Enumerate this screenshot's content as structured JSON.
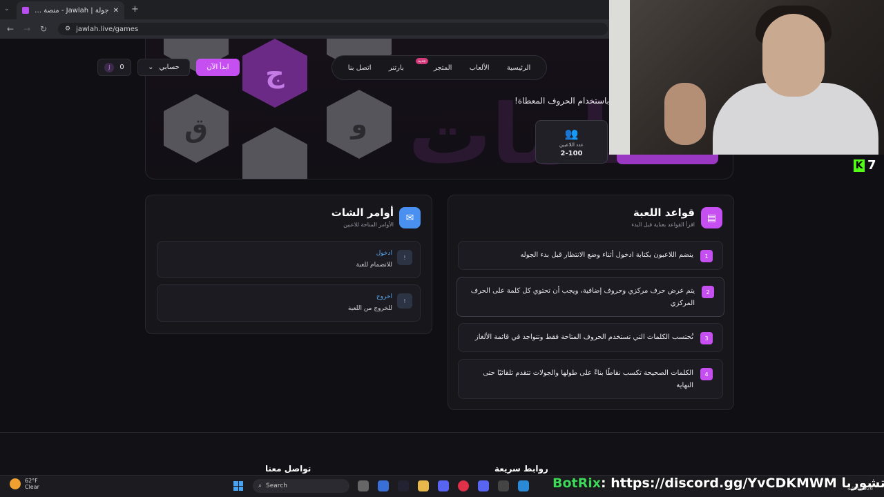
{
  "browser": {
    "tab_title": "جولة | Jawlah - منصة الألعاب الت...",
    "tab_badge": "جولة",
    "url": "jawlah.live/games"
  },
  "nav": {
    "items": [
      "الرئيسية",
      "الألعاب",
      "المتجر",
      "بارتنر",
      "اتصل بنا"
    ],
    "new_badge": "جديد",
    "start_button": "ابدأ الآن",
    "account_button": "حسابي",
    "coins_value": "0",
    "coins_icon_letter": "J"
  },
  "hero": {
    "subtitle": "باستخدام الحروف المعطاة!",
    "hex_letters": [
      "ق",
      "ج",
      "و"
    ],
    "players_label": "عدد اللاعبين",
    "players_value": "2-100"
  },
  "rules": {
    "title": "قواعد اللعبة",
    "subtitle": "اقرأ القواعد بعناية قبل البدء",
    "items": [
      {
        "num": "1",
        "text": "ينضم اللاعبون بكتابة ادخول أثناء وضع الانتظار قبل بدء الجوله"
      },
      {
        "num": "2",
        "text": "يتم عرض حرف مركزي وحروف إضافية، ويجب أن تحتوي كل كلمة على الحرف المركزي"
      },
      {
        "num": "3",
        "text": "تُحتسب الكلمات التي تستخدم الحروف المتاحة فقط وتتواجد في قائمة الألغاز"
      },
      {
        "num": "4",
        "text": "الكلمات الصحيحة تكسب نقاطًا بناءً على طولها والجولات تتقدم تلقائيًا حتى النهاية"
      }
    ]
  },
  "chat": {
    "title": "أوامر الشات",
    "subtitle": "الأوامر المتاحة للاعبين",
    "commands": [
      {
        "num": "!",
        "name": "ادخول",
        "desc": "للانضمام للعبة"
      },
      {
        "num": "!",
        "name": "اخروج",
        "desc": "للخروج من اللعبة"
      }
    ]
  },
  "footer": {
    "quick_links": "روابط سريعة",
    "contact": "تواصل معنا"
  },
  "overlay": {
    "kick_count": "7",
    "ticker_bot": "BotRix",
    "ticker_text": ": https://discord.gg/YvCDKMWM لـ ك.نيق تشوريا"
  },
  "taskbar": {
    "temp": "62°F",
    "condition": "Clear",
    "search": "Search",
    "date": "1/14/2026"
  },
  "colors": {
    "accent": "#c64ff2",
    "kick": "#53fc18",
    "link": "#5aa9f0"
  }
}
